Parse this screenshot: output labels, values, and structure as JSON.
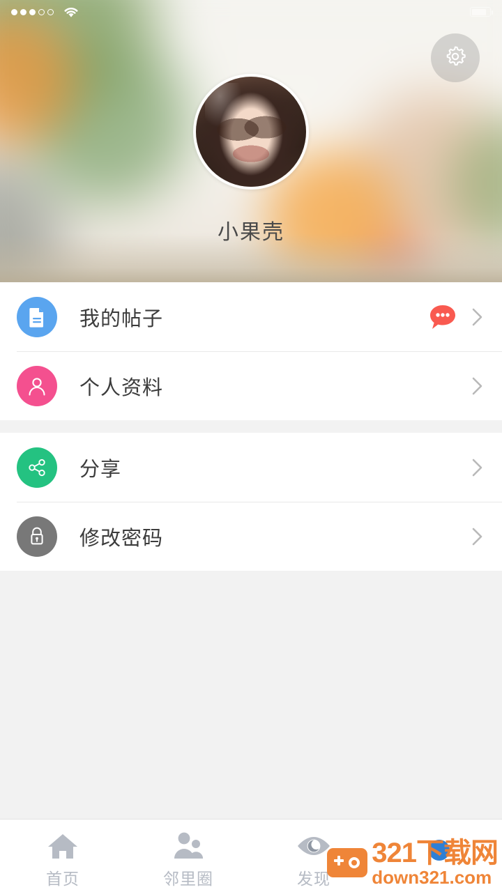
{
  "statusbar": {
    "signal_dots": [
      "on",
      "on",
      "on",
      "off",
      "off"
    ],
    "wifi_icon": "wifi-icon",
    "time": "",
    "battery_icon": "battery-icon"
  },
  "header": {
    "settings_icon": "gear-icon",
    "avatar": "user-avatar",
    "username": "小果壳"
  },
  "list_groups": [
    {
      "rows": [
        {
          "icon": "document-icon",
          "icon_color": "#5aa5ef",
          "label": "我的帖子",
          "badge": "speech-bubble-badge",
          "badge_color": "#f95a50",
          "chevron": "chevron-right-icon"
        },
        {
          "icon": "person-icon",
          "icon_color": "#f4508f",
          "label": "个人资料",
          "badge": null,
          "chevron": "chevron-right-icon"
        }
      ]
    },
    {
      "rows": [
        {
          "icon": "share-icon",
          "icon_color": "#24c281",
          "label": "分享",
          "badge": null,
          "chevron": "chevron-right-icon"
        },
        {
          "icon": "lock-icon",
          "icon_color": "#787878",
          "label": "修改密码",
          "badge": null,
          "chevron": "chevron-right-icon"
        }
      ]
    }
  ],
  "tabbar": {
    "items": [
      {
        "icon": "home-icon",
        "label": "首页",
        "active": false
      },
      {
        "icon": "people-icon",
        "label": "邻里圈",
        "active": false
      },
      {
        "icon": "eye-icon",
        "label": "发现",
        "active": false
      },
      {
        "icon": "profile-dot-icon",
        "label": "",
        "active": true
      }
    ],
    "inactive_color": "#b6bbc4",
    "active_color": "#2f7fd4"
  },
  "watermark": {
    "icon": "gamepad-icon",
    "line1": "321下载网",
    "line2": "down321.com",
    "color": "#ef7f2e"
  }
}
